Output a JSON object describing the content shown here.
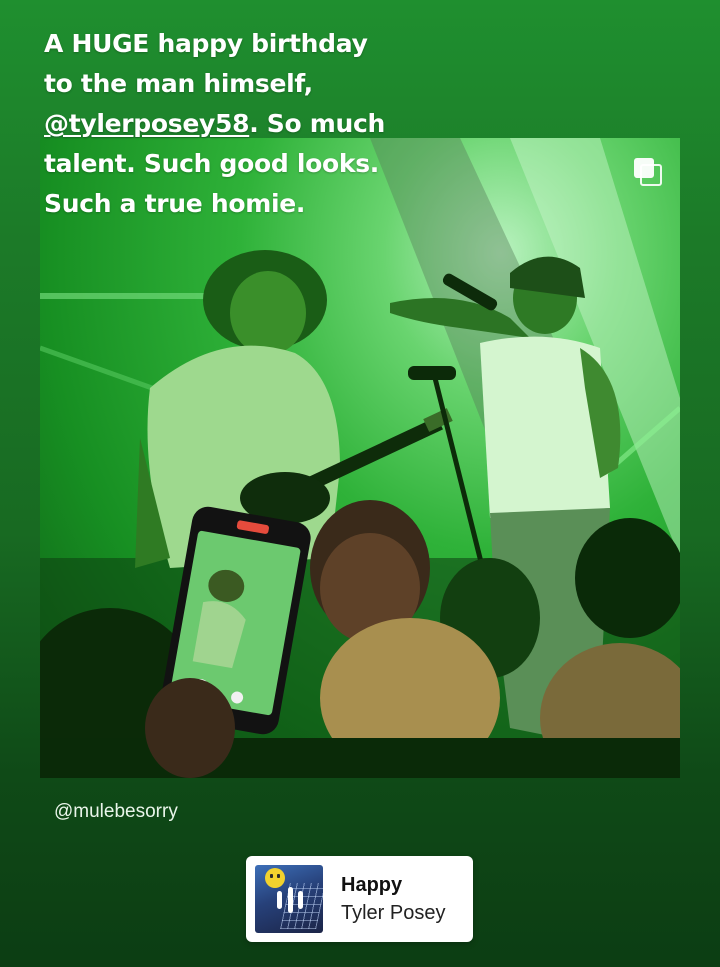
{
  "story": {
    "caption": {
      "line1": "A HUGE happy birthday",
      "line2": "to the man himself,",
      "mention": "@tylerposey58",
      "line3_rest": ". So much",
      "line4": "talent. Such good looks.",
      "line5": "Such a true homie."
    },
    "photo": {
      "multi_photo_icon": "multiple-photos-icon"
    },
    "credit": "@mulebesorry",
    "music": {
      "title": "Happy",
      "artist": "Tyler Posey",
      "album_icon": "album-art-with-playing-bars-icon"
    }
  },
  "colors": {
    "background_top": "#1f8f2f",
    "background_bottom": "#0c3d13",
    "caption_text": "#ffffff",
    "sticker_bg": "#ffffff"
  }
}
